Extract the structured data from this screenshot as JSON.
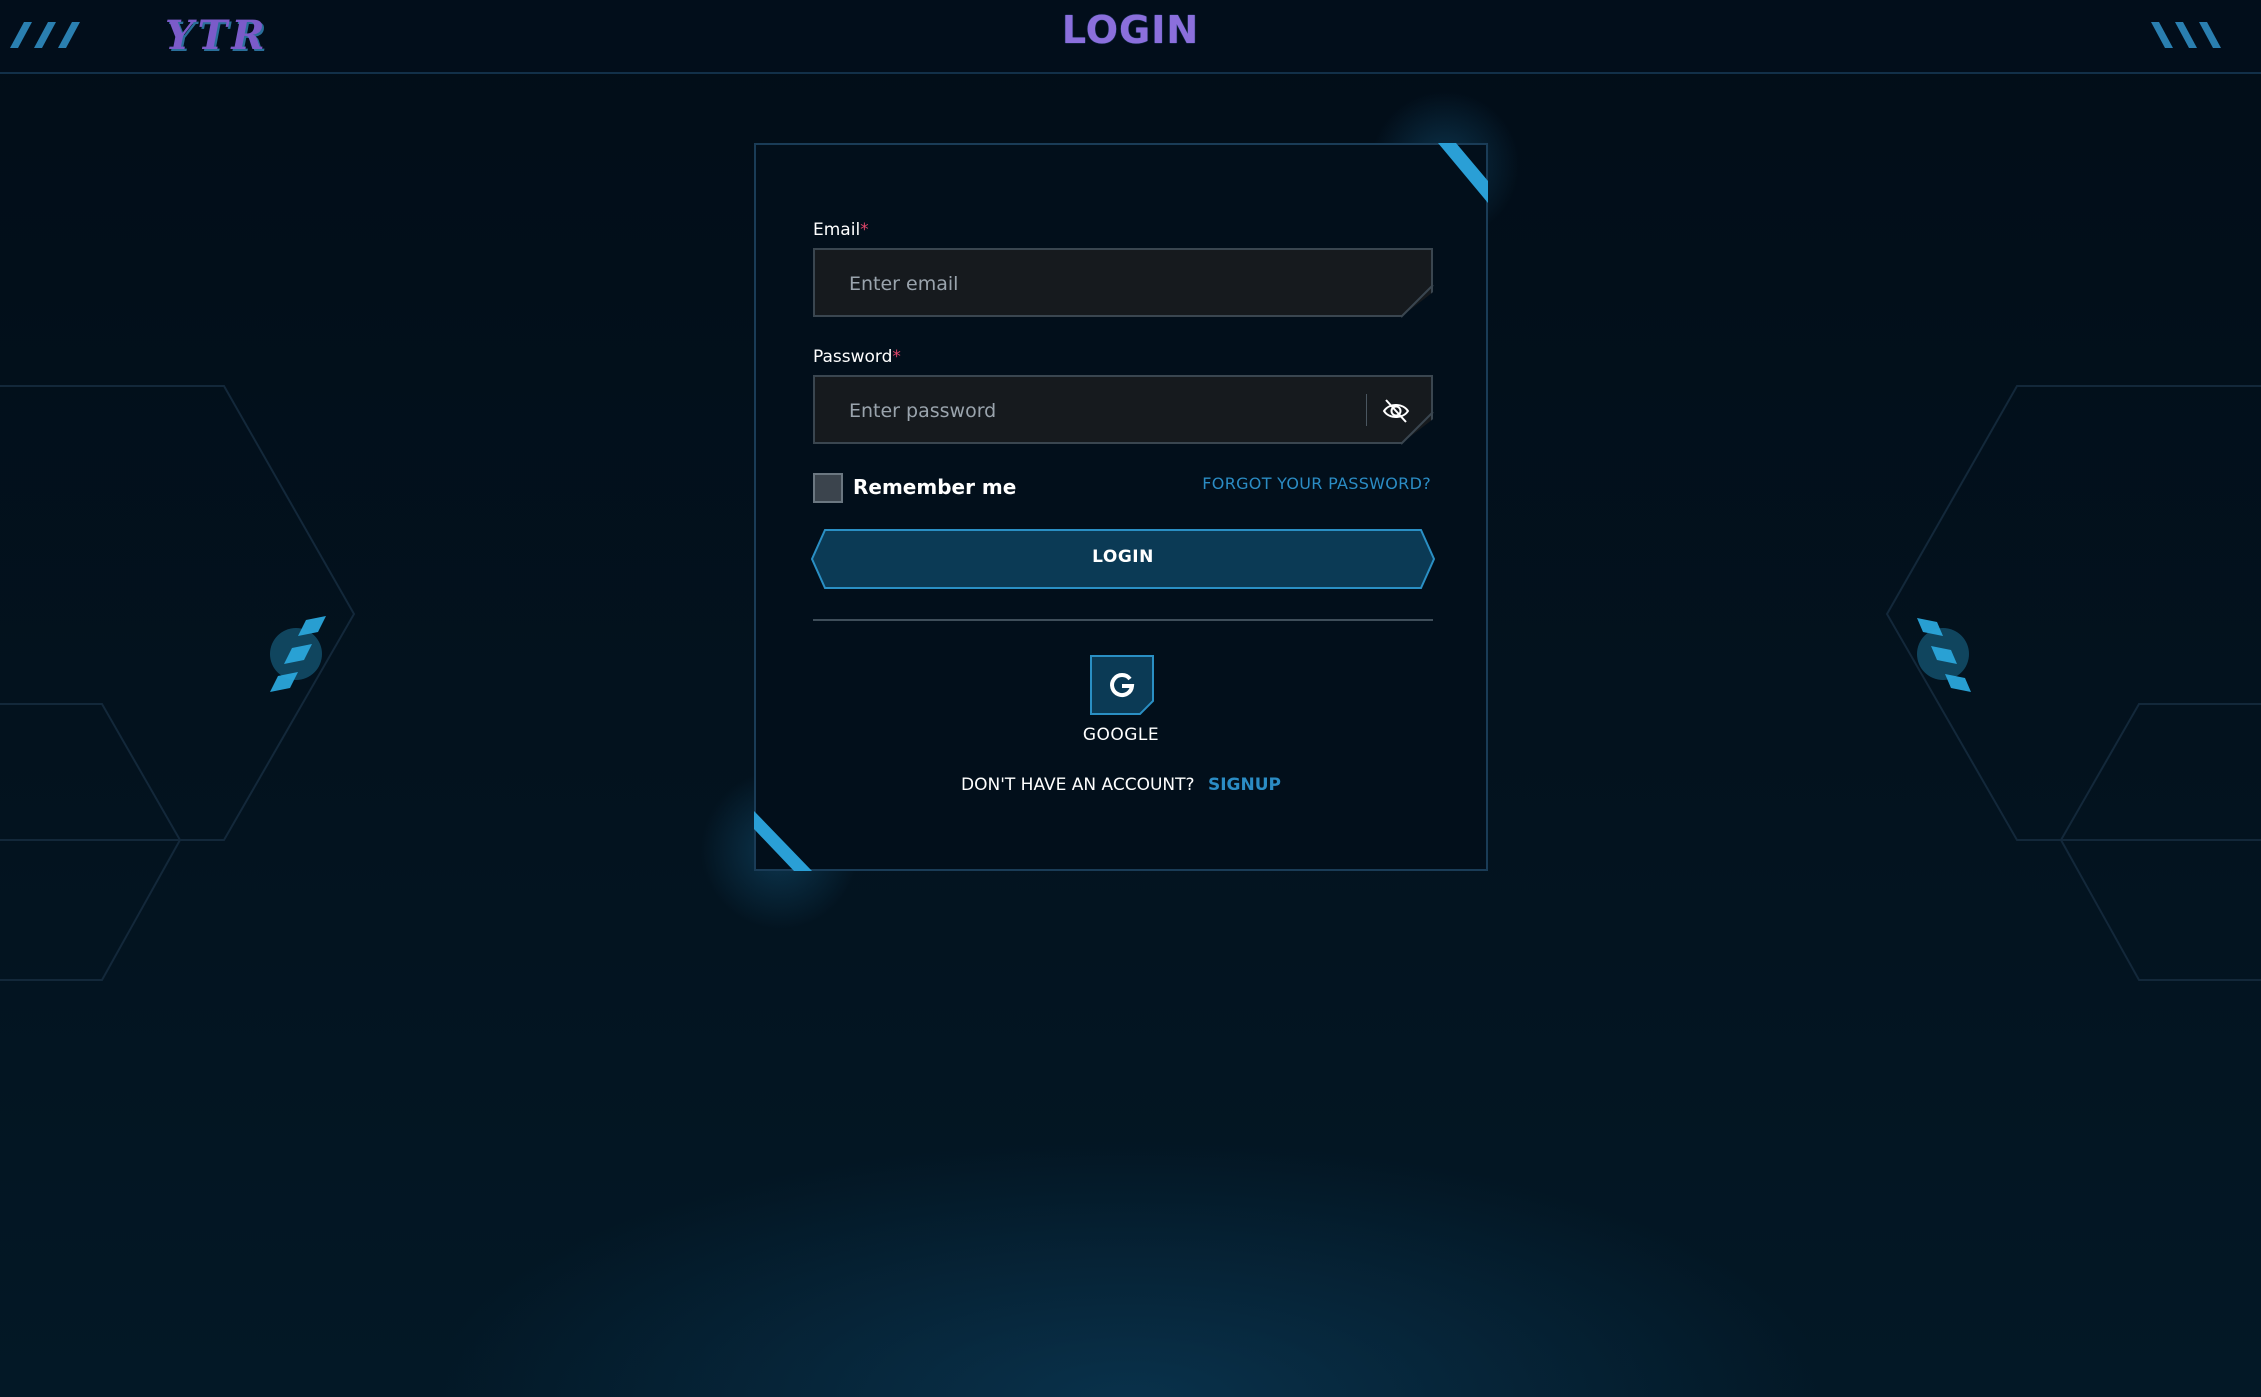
{
  "header": {
    "logo_text": "YTR",
    "title": "LOGIN"
  },
  "form": {
    "email": {
      "label": "Email",
      "required_mark": "*",
      "placeholder": "Enter email",
      "value": ""
    },
    "password": {
      "label": "Password",
      "required_mark": "*",
      "placeholder": "Enter password",
      "value": "",
      "toggle_icon": "eye-off-icon"
    },
    "remember_me": {
      "label": "Remember me",
      "checked": false
    },
    "forgot_password_label": "FORGOT YOUR PASSWORD?",
    "login_button_label": "LOGIN",
    "social": {
      "google_icon_letter": "G",
      "google_label": "GOOGLE"
    },
    "signup_prompt": "DON'T HAVE AN ACCOUNT?",
    "signup_link": "SIGNUP"
  },
  "colors": {
    "accent": "#2b8cc4",
    "title": "#8b6fdc",
    "button_fill": "#0b3a55",
    "required": "#e0466a",
    "background": "#03121f"
  }
}
